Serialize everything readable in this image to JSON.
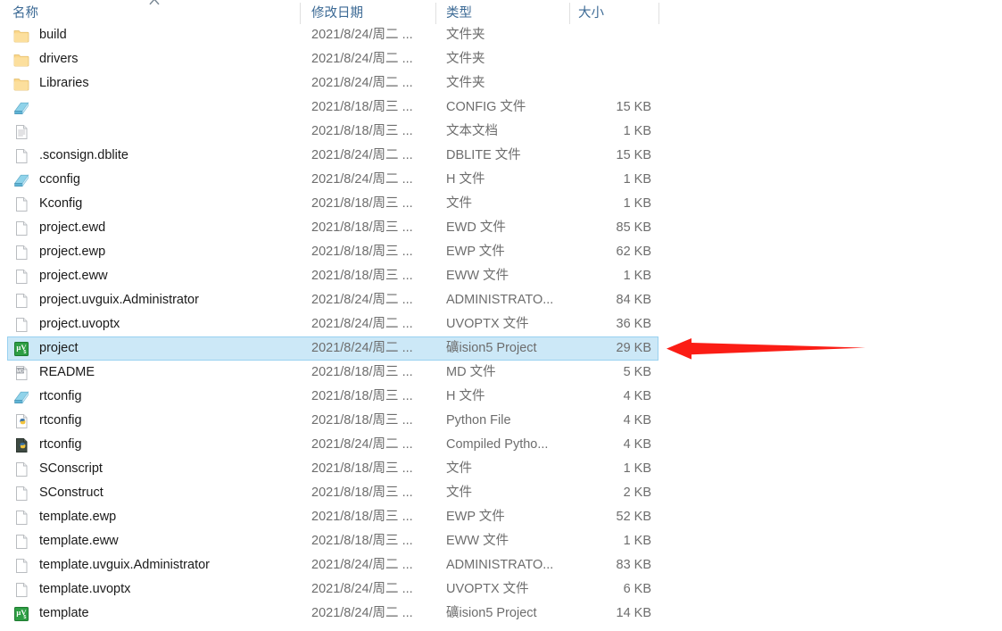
{
  "columns": {
    "name": "名称",
    "date": "修改日期",
    "type": "类型",
    "size": "大小",
    "sort_indicator": "chevron-up-icon",
    "sort_column": "名称",
    "sort_direction": "ascending"
  },
  "colors": {
    "header_text": "#3c6a95",
    "row_text": "#1a1a1a",
    "meta_text": "#6d6d6d",
    "selection_fill": "#cce8f7",
    "selection_border": "#99d1f0",
    "folder_icon": "#fcd88a",
    "annotation_arrow": "#fb1d15",
    "uvision_icon": "#2e9e44"
  },
  "annotation": {
    "type": "arrow",
    "direction": "left",
    "color": "#fb1d15",
    "points_at": "project"
  },
  "rows": [
    {
      "name": "build",
      "date": "2021/8/24/周二 ...",
      "type": "文件夹",
      "size": "",
      "icon": "folder-icon"
    },
    {
      "name": "drivers",
      "date": "2021/8/24/周二 ...",
      "type": "文件夹",
      "size": "",
      "icon": "folder-icon"
    },
    {
      "name": "Libraries",
      "date": "2021/8/24/周二 ...",
      "type": "文件夹",
      "size": "",
      "icon": "folder-icon"
    },
    {
      "name": "",
      "date": "2021/8/18/周三 ...",
      "type": "CONFIG 文件",
      "size": "15 KB",
      "icon": "h-file-icon"
    },
    {
      "name": "",
      "date": "2021/8/18/周三 ...",
      "type": "文本文档",
      "size": "1 KB",
      "icon": "text-document-icon"
    },
    {
      "name": ".sconsign.dblite",
      "date": "2021/8/24/周二 ...",
      "type": "DBLITE 文件",
      "size": "15 KB",
      "icon": "generic-file-icon"
    },
    {
      "name": "cconfig",
      "date": "2021/8/24/周二 ...",
      "type": "H 文件",
      "size": "1 KB",
      "icon": "h-file-icon"
    },
    {
      "name": "Kconfig",
      "date": "2021/8/18/周三 ...",
      "type": "文件",
      "size": "1 KB",
      "icon": "generic-file-icon"
    },
    {
      "name": "project.ewd",
      "date": "2021/8/18/周三 ...",
      "type": "EWD 文件",
      "size": "85 KB",
      "icon": "generic-file-icon"
    },
    {
      "name": "project.ewp",
      "date": "2021/8/18/周三 ...",
      "type": "EWP 文件",
      "size": "62 KB",
      "icon": "generic-file-icon"
    },
    {
      "name": "project.eww",
      "date": "2021/8/18/周三 ...",
      "type": "EWW 文件",
      "size": "1 KB",
      "icon": "generic-file-icon"
    },
    {
      "name": "project.uvguix.Administrator",
      "date": "2021/8/24/周二 ...",
      "type": "ADMINISTRATO...",
      "size": "84 KB",
      "icon": "generic-file-icon"
    },
    {
      "name": "project.uvoptx",
      "date": "2021/8/24/周二 ...",
      "type": "UVOPTX 文件",
      "size": "36 KB",
      "icon": "generic-file-icon"
    },
    {
      "name": "project",
      "date": "2021/8/24/周二 ...",
      "type": "礦ision5 Project",
      "size": "29 KB",
      "icon": "uvision-project-icon",
      "selected": true
    },
    {
      "name": "README",
      "date": "2021/8/18/周三 ...",
      "type": "MD 文件",
      "size": "5 KB",
      "icon": "md-file-icon"
    },
    {
      "name": "rtconfig",
      "date": "2021/8/18/周三 ...",
      "type": "H 文件",
      "size": "4 KB",
      "icon": "h-file-icon"
    },
    {
      "name": "rtconfig",
      "date": "2021/8/18/周三 ...",
      "type": "Python File",
      "size": "4 KB",
      "icon": "python-file-icon"
    },
    {
      "name": "rtconfig",
      "date": "2021/8/24/周二 ...",
      "type": "Compiled Pytho...",
      "size": "4 KB",
      "icon": "compiled-python-file-icon"
    },
    {
      "name": "SConscript",
      "date": "2021/8/18/周三 ...",
      "type": "文件",
      "size": "1 KB",
      "icon": "generic-file-icon"
    },
    {
      "name": "SConstruct",
      "date": "2021/8/18/周三 ...",
      "type": "文件",
      "size": "2 KB",
      "icon": "generic-file-icon"
    },
    {
      "name": "template.ewp",
      "date": "2021/8/18/周三 ...",
      "type": "EWP 文件",
      "size": "52 KB",
      "icon": "generic-file-icon"
    },
    {
      "name": "template.eww",
      "date": "2021/8/18/周三 ...",
      "type": "EWW 文件",
      "size": "1 KB",
      "icon": "generic-file-icon"
    },
    {
      "name": "template.uvguix.Administrator",
      "date": "2021/8/24/周二 ...",
      "type": "ADMINISTRATO...",
      "size": "83 KB",
      "icon": "generic-file-icon"
    },
    {
      "name": "template.uvoptx",
      "date": "2021/8/24/周二 ...",
      "type": "UVOPTX 文件",
      "size": "6 KB",
      "icon": "generic-file-icon"
    },
    {
      "name": "template",
      "date": "2021/8/24/周二 ...",
      "type": "礦ision5 Project",
      "size": "14 KB",
      "icon": "uvision-project-icon"
    }
  ]
}
